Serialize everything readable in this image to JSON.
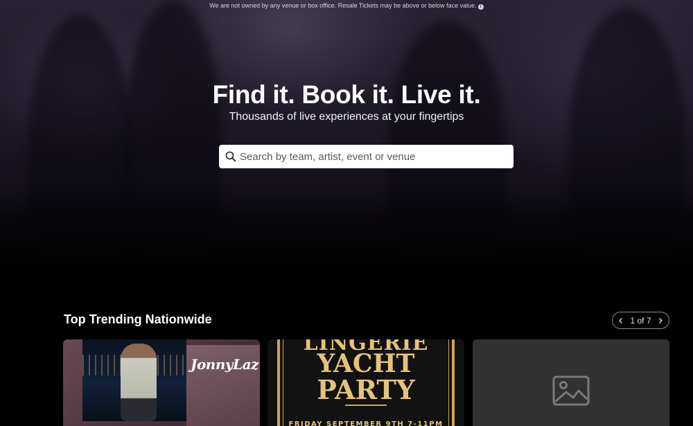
{
  "notice": {
    "text": "We are not owned by any venue or box office. Resale Tickets may be above or below face value.",
    "icon": "info-icon"
  },
  "hero": {
    "headline": "Find it. Book it. Live it.",
    "subhead": "Thousands of live experiences at your fingertips"
  },
  "search": {
    "placeholder": "Search by team, artist, event or venue",
    "value": ""
  },
  "trending": {
    "title": "Top Trending Nationwide",
    "pager": {
      "current": "1 of 7"
    },
    "cards": [
      {
        "logo_text": "JonnyLaz"
      },
      {
        "lines": [
          "LINGERIE",
          "YACHT",
          "PARTY",
          "FRIDAY SEPTEMBER 9TH 7-11PM"
        ]
      },
      {
        "placeholder_icon": "image-icon"
      }
    ]
  },
  "colors": {
    "background": "#000000",
    "search_bg": "#ffffff",
    "gold": "#e4c37a",
    "placeholder_card": "#323232"
  }
}
